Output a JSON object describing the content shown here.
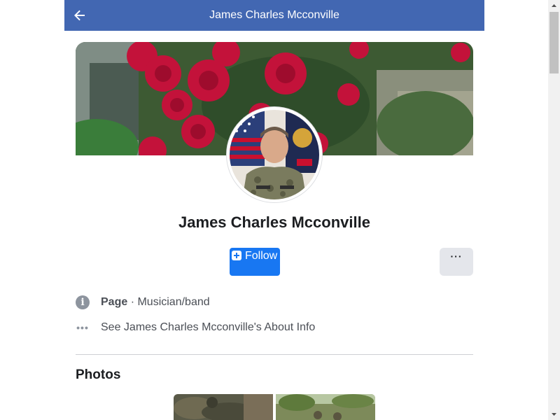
{
  "header": {
    "title": "James Charles Mcconville",
    "back_icon": "arrow-left-icon"
  },
  "profile": {
    "name": "James Charles Mcconville",
    "cover_image": "red roses cover photo",
    "avatar_image": "man in military uniform in front of flags"
  },
  "actions": {
    "follow_label": "Follow",
    "follow_icon": "follow-plus-icon",
    "more_label": "···",
    "colors": {
      "follow_bg": "#1877f2",
      "more_bg": "#e4e6eb",
      "header_bg": "#4267b2"
    }
  },
  "info": {
    "page_label": "Page",
    "separator": " · ",
    "category": "Musician/band",
    "about_link": "See James Charles Mcconville's About Info",
    "info_icon": "info-circle-icon",
    "dots_icon": "more-dots-icon"
  },
  "photos": {
    "title": "Photos",
    "items": [
      {
        "description": "soldiers in camouflage"
      },
      {
        "description": "soldiers outdoors"
      }
    ]
  }
}
